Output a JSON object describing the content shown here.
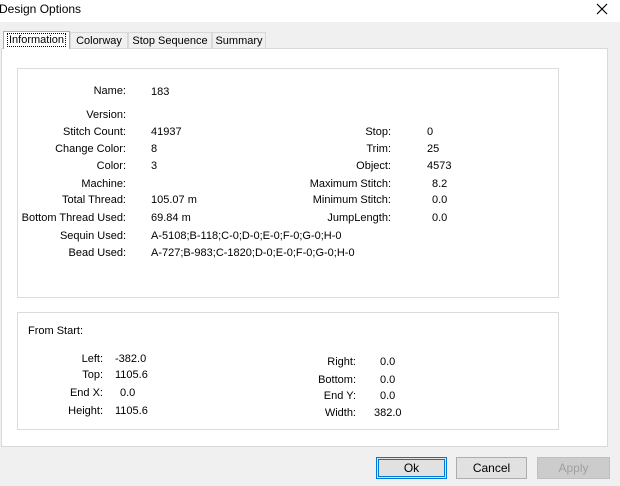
{
  "window": {
    "title": "Design Options",
    "close_icon": "close-icon"
  },
  "tabs": [
    "Information",
    "Colorway",
    "Stop Sequence",
    "Summary"
  ],
  "info": {
    "name_label": "Name:",
    "name_value": "183",
    "version_label": "Version:",
    "version_value": "",
    "stitch_count_label": "Stitch Count:",
    "stitch_count_value": "41937",
    "change_color_label": "Change Color:",
    "change_color_value": "8",
    "color_label": "Color:",
    "color_value": "3",
    "machine_label": "Machine:",
    "machine_value": "",
    "total_thread_label": "Total Thread:",
    "total_thread_value": "105.07 m",
    "bottom_thread_label": "Bottom Thread Used:",
    "bottom_thread_value": "69.84 m",
    "sequin_label": "Sequin Used:",
    "sequin_value": "A-5108;B-118;C-0;D-0;E-0;F-0;G-0;H-0",
    "bead_label": "Bead Used:",
    "bead_value": "A-727;B-983;C-1820;D-0;E-0;F-0;G-0;H-0",
    "stop_label": "Stop:",
    "stop_value": "0",
    "trim_label": "Trim:",
    "trim_value": "25",
    "object_label": "Object:",
    "object_value": "4573",
    "max_stitch_label": "Maximum Stitch:",
    "max_stitch_value": "8.2",
    "min_stitch_label": "Minimum Stitch:",
    "min_stitch_value": "0.0",
    "jump_label": "JumpLength:",
    "jump_value": "0.0"
  },
  "from_start": {
    "heading": "From Start:",
    "left_label": "Left:",
    "left_value": "-382.0",
    "top_label": "Top:",
    "top_value": "1105.6",
    "endx_label": "End X:",
    "endx_value": "0.0",
    "height_label": "Height:",
    "height_value": "1105.6",
    "right_label": "Right:",
    "right_value": "0.0",
    "bottom_label": "Bottom:",
    "bottom_value": "0.0",
    "endy_label": "End Y:",
    "endy_value": "0.0",
    "width_label": "Width:",
    "width_value": "382.0"
  },
  "buttons": {
    "ok": "Ok",
    "cancel": "Cancel",
    "apply": "Apply"
  }
}
